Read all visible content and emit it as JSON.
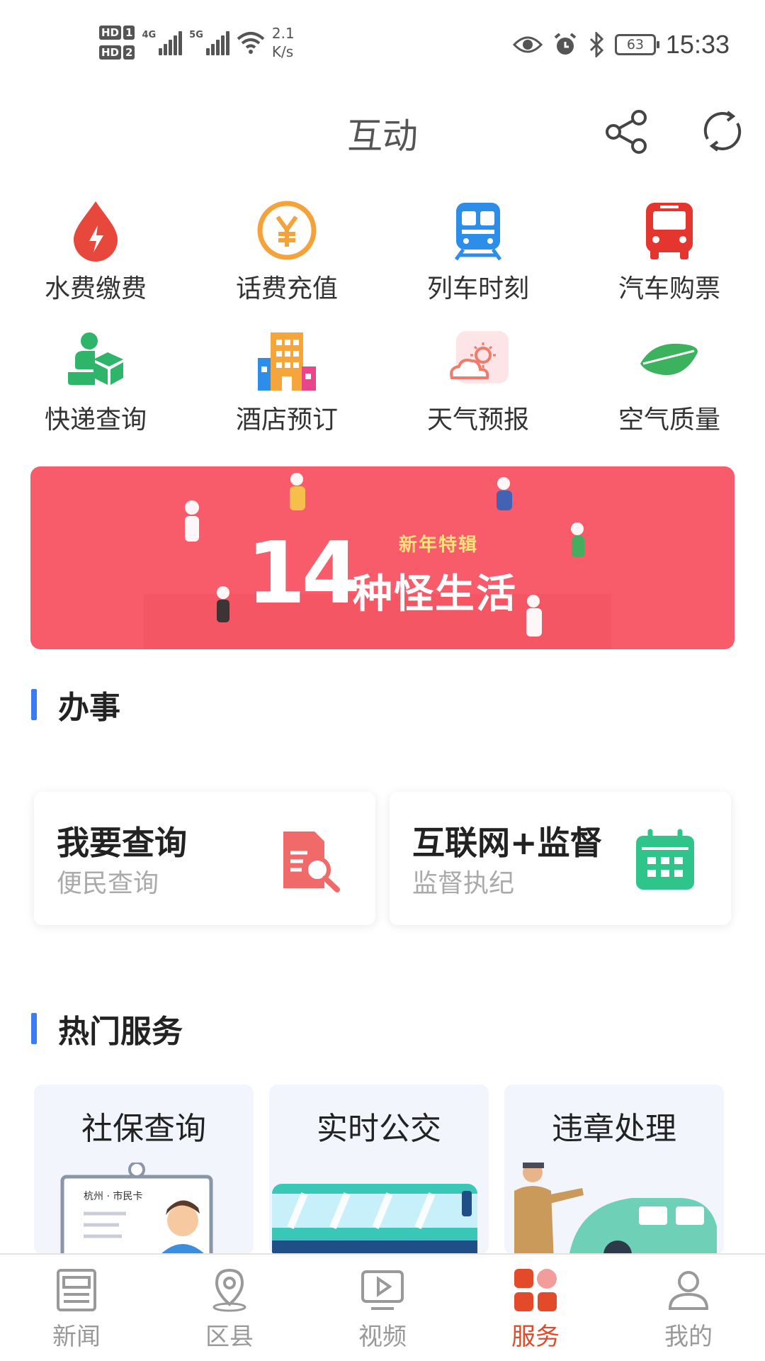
{
  "status_bar": {
    "hd1": "HD",
    "hd1_sim": "1",
    "hd2": "HD",
    "hd2_sim": "2",
    "net1": "4G",
    "net2": "5G",
    "speed_value": "2.1",
    "speed_unit": "K/s",
    "battery": "63",
    "time": "15:33"
  },
  "header": {
    "title": "互动"
  },
  "utilities": [
    {
      "label": "水费缴费",
      "icon": "water-drop-icon",
      "color": "#e8473c"
    },
    {
      "label": "话费充值",
      "icon": "yen-coin-icon",
      "color": "#f6a23a"
    },
    {
      "label": "列车时刻",
      "icon": "train-icon",
      "color": "#2c8ee8"
    },
    {
      "label": "汽车购票",
      "icon": "bus-icon",
      "color": "#e4362f"
    },
    {
      "label": "快递查询",
      "icon": "courier-icon",
      "color": "#2fb56a"
    },
    {
      "label": "酒店预订",
      "icon": "hotel-icon",
      "color": "#f4a53c"
    },
    {
      "label": "天气预报",
      "icon": "weather-icon",
      "color": "#f58b7d"
    },
    {
      "label": "空气质量",
      "icon": "leaf-icon",
      "color": "#3cb25e"
    }
  ],
  "banner": {
    "tag": "新年特辑",
    "number": "14",
    "title": "种怪生活"
  },
  "section_affairs": {
    "title": "办事",
    "cards": [
      {
        "title": "我要查询",
        "subtitle": "便民查询",
        "icon": "document-search-icon"
      },
      {
        "title": "互联网+监督",
        "subtitle": "监督执纪",
        "icon": "calendar-icon"
      }
    ]
  },
  "section_hot": {
    "title": "热门服务",
    "cards": [
      {
        "title": "社保查询"
      },
      {
        "title": "实时公交"
      },
      {
        "title": "违章处理"
      }
    ],
    "card_caption": "杭州 · 市民卡"
  },
  "tabs": [
    {
      "label": "新闻",
      "icon": "news-icon",
      "active": false
    },
    {
      "label": "区县",
      "icon": "location-pin-icon",
      "active": false
    },
    {
      "label": "视频",
      "icon": "video-icon",
      "active": false
    },
    {
      "label": "服务",
      "icon": "services-grid-icon",
      "active": true
    },
    {
      "label": "我的",
      "icon": "user-icon",
      "active": false
    }
  ],
  "colors": {
    "accent_blue": "#3b7bf5",
    "active_tab": "#e24a2a",
    "banner_bg": "#f85c6a"
  }
}
